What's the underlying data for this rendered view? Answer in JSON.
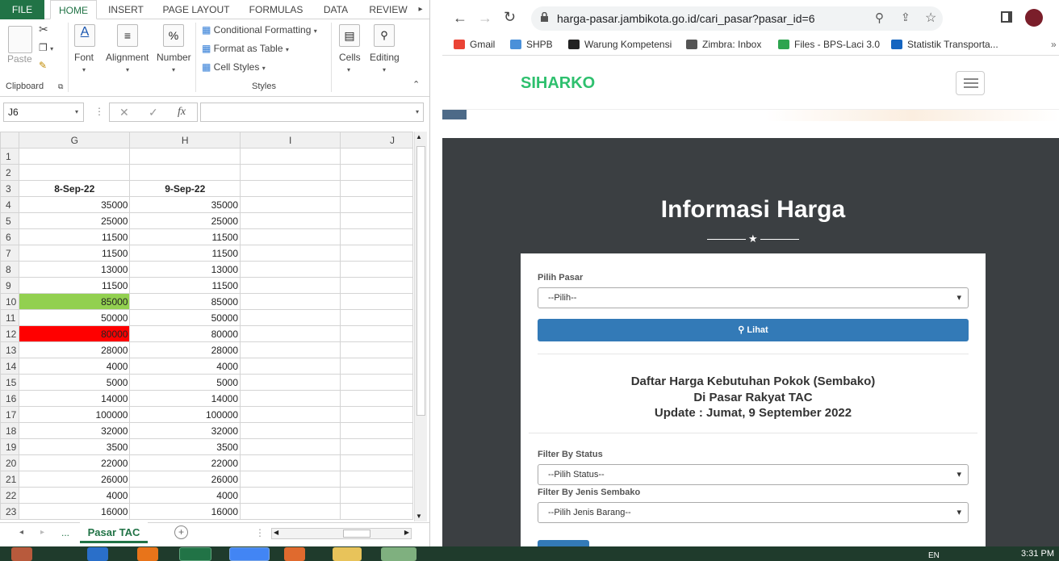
{
  "excel": {
    "tabs": {
      "file": "FILE",
      "home": "HOME",
      "insert": "INSERT",
      "page_layout": "PAGE LAYOUT",
      "formulas": "FORMULAS",
      "data": "DATA",
      "review": "REVIEW"
    },
    "ribbon": {
      "paste": "Paste",
      "clipboard": "Clipboard",
      "font": "Font",
      "alignment": "Alignment",
      "number": "Number",
      "percent_glyph": "%",
      "conditional_formatting": "Conditional Formatting",
      "format_as_table": "Format as Table",
      "cell_styles": "Cell Styles",
      "styles": "Styles",
      "cells": "Cells",
      "editing": "Editing"
    },
    "name_box": "J6",
    "fx_label": "fx",
    "columns": [
      "G",
      "H",
      "I",
      "J"
    ],
    "rows": [
      {
        "n": "1",
        "g": "",
        "h": ""
      },
      {
        "n": "2",
        "g": "",
        "h": ""
      },
      {
        "n": "3",
        "g": "8-Sep-22",
        "h": "9-Sep-22"
      },
      {
        "n": "4",
        "g": "35000",
        "h": "35000"
      },
      {
        "n": "5",
        "g": "25000",
        "h": "25000"
      },
      {
        "n": "6",
        "g": "11500",
        "h": "11500"
      },
      {
        "n": "7",
        "g": "11500",
        "h": "11500"
      },
      {
        "n": "8",
        "g": "13000",
        "h": "13000"
      },
      {
        "n": "9",
        "g": "11500",
        "h": "11500"
      },
      {
        "n": "10",
        "g": "85000",
        "h": "85000",
        "g_fill": "#92d050"
      },
      {
        "n": "11",
        "g": "50000",
        "h": "50000"
      },
      {
        "n": "12",
        "g": "80000",
        "h": "80000",
        "g_fill": "#ff0000"
      },
      {
        "n": "13",
        "g": "28000",
        "h": "28000"
      },
      {
        "n": "14",
        "g": "4000",
        "h": "4000"
      },
      {
        "n": "15",
        "g": "5000",
        "h": "5000"
      },
      {
        "n": "16",
        "g": "14000",
        "h": "14000"
      },
      {
        "n": "17",
        "g": "100000",
        "h": "100000"
      },
      {
        "n": "18",
        "g": "32000",
        "h": "32000"
      },
      {
        "n": "19",
        "g": "3500",
        "h": "3500"
      },
      {
        "n": "20",
        "g": "22000",
        "h": "22000"
      },
      {
        "n": "21",
        "g": "26000",
        "h": "26000"
      },
      {
        "n": "22",
        "g": "4000",
        "h": "4000"
      },
      {
        "n": "23",
        "g": "16000",
        "h": "16000"
      }
    ],
    "sheet_more": "...",
    "sheet_tab": "Pasar TAC",
    "accent": "#217346"
  },
  "browser": {
    "url": "harga-pasar.jambikota.go.id/cari_pasar?pasar_id=6",
    "bookmarks": [
      {
        "label": "Gmail",
        "color": "#ea4335"
      },
      {
        "label": "SHPB",
        "color": "#4a90d9"
      },
      {
        "label": "Warung Kompetensi",
        "color": "#222222"
      },
      {
        "label": "Zimbra: Inbox",
        "color": "#555555"
      },
      {
        "label": "Files - BPS-Laci 3.0",
        "color": "#2ea44f"
      },
      {
        "label": "Statistik Transporta...",
        "color": "#1565c0"
      }
    ]
  },
  "site": {
    "brand": "SIHARKO",
    "brand_color": "#2ec06e",
    "hero_title": "Informasi Harga",
    "star": "★",
    "pilih_pasar_label": "Pilih Pasar",
    "pilih_pasar_value": "--Pilih--",
    "lihat_button": "Lihat",
    "heading_1": "Daftar Harga Kebutuhan Pokok (Sembako)",
    "heading_2": "Di Pasar Rakyat TAC",
    "heading_3": "Update : Jumat, 9 September 2022",
    "filter_status_label": "Filter By Status",
    "filter_status_value": "--Pilih Status--",
    "filter_jenis_label": "Filter By Jenis Sembako",
    "filter_jenis_value": "--Pilih Jenis Barang--",
    "button_color": "#337ab7"
  },
  "taskbar": {
    "lang": "EN",
    "clock": "3:31 PM"
  }
}
